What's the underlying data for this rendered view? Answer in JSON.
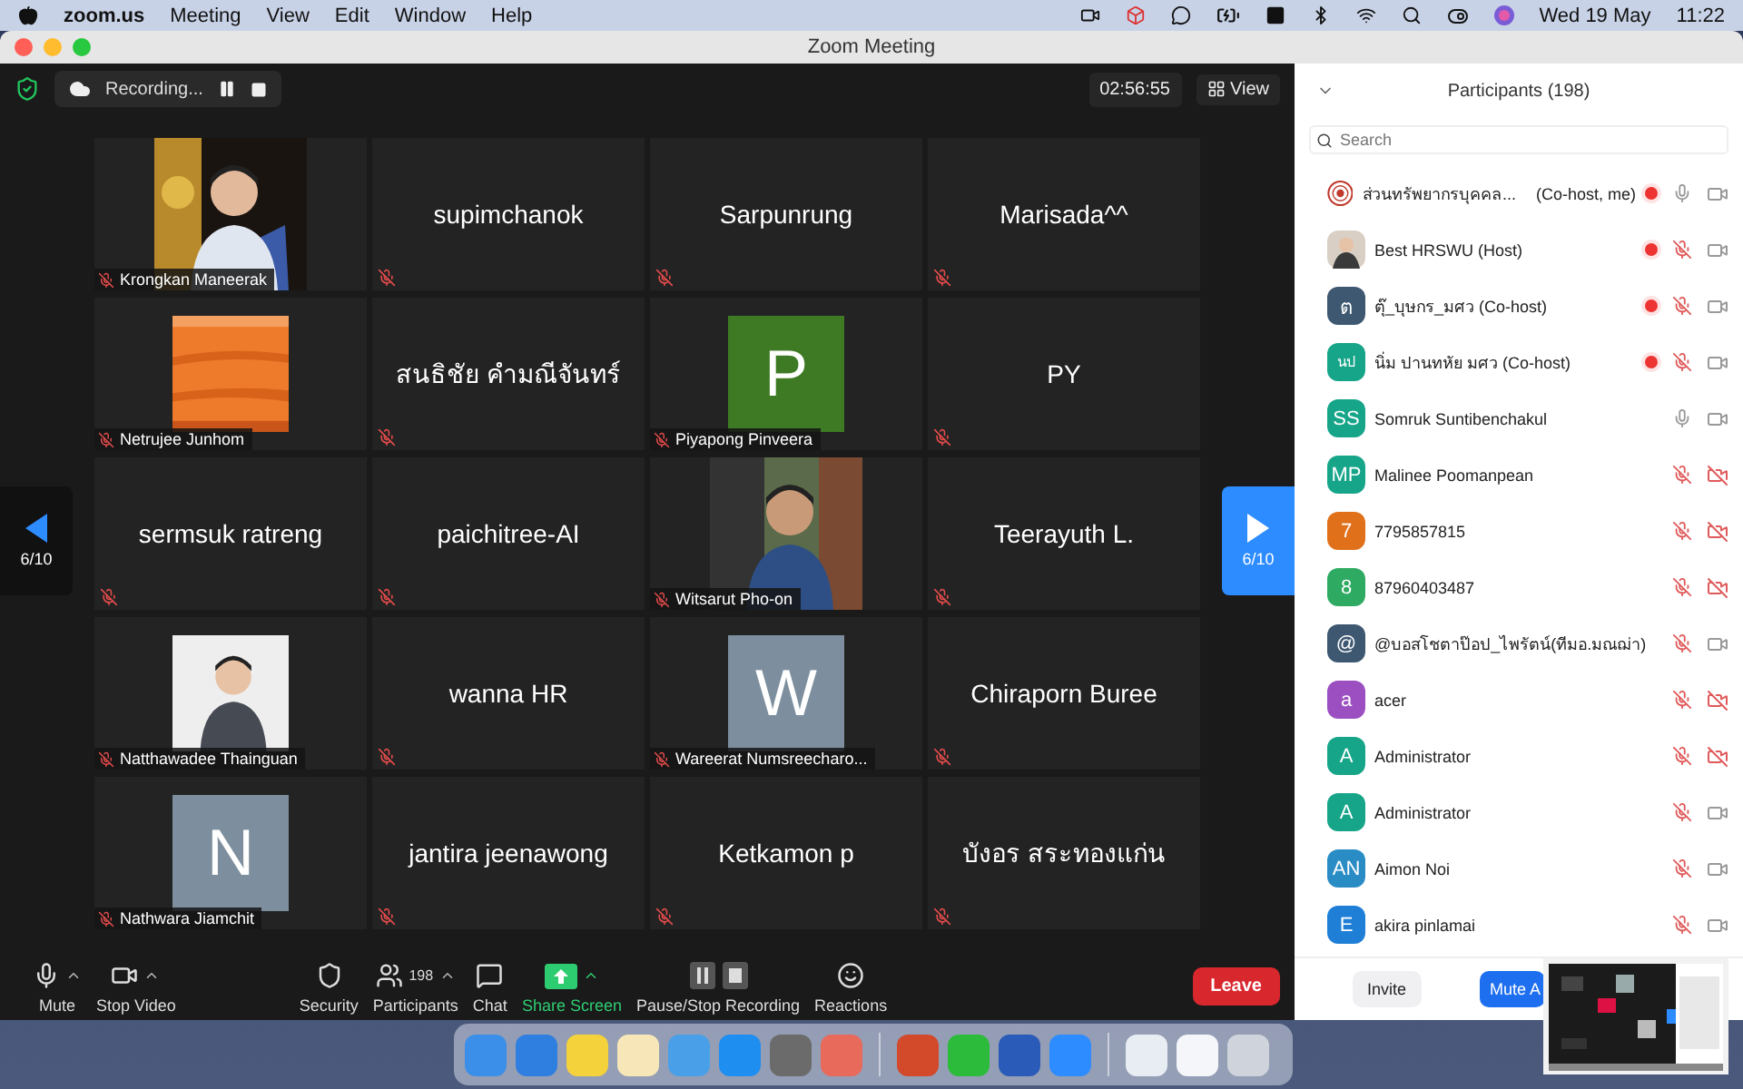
{
  "menu_bar": {
    "app": "zoom.us",
    "menus": [
      "Meeting",
      "View",
      "Edit",
      "Window",
      "Help"
    ],
    "date": "Wed 19 May",
    "time": "11:22"
  },
  "window": {
    "title": "Zoom Meeting"
  },
  "meeting_bar": {
    "recording": "Recording...",
    "timer": "02:56:55",
    "view": "View"
  },
  "pager": {
    "previous": "6/10",
    "next": "6/10"
  },
  "tiles": [
    {
      "name": "Krongkan Maneerak",
      "muted": true
    },
    {
      "kind": "name",
      "name": "supimchanok",
      "muted": true
    },
    {
      "kind": "name",
      "name": "Sarpunrung",
      "muted": true
    },
    {
      "kind": "name",
      "name": "Marisada^^",
      "muted": true
    },
    {
      "name": "Netrujee Junhom",
      "muted": true
    },
    {
      "kind": "name",
      "name": "สนธิชัย คำมณีจันทร์",
      "muted": true
    },
    {
      "kind": "avatar",
      "letter": "P",
      "color": "#3e7a23",
      "name": "Piyapong Pinveera",
      "muted": true
    },
    {
      "kind": "name",
      "name": "PY",
      "muted": true
    },
    {
      "kind": "name",
      "name": "sermsuk ratreng",
      "muted": true
    },
    {
      "kind": "name",
      "name": "paichitree-AI",
      "muted": true
    },
    {
      "name": "Witsarut Pho-on",
      "muted": true
    },
    {
      "kind": "name",
      "name": "Teerayuth L.",
      "muted": true
    },
    {
      "name": "Natthawadee Thainguan",
      "muted": true
    },
    {
      "kind": "name",
      "name": "wanna HR",
      "muted": true
    },
    {
      "kind": "avatar",
      "letter": "W",
      "color": "#7d8f9e",
      "name": "Wareerat Numsreecharo...",
      "muted": true
    },
    {
      "kind": "name",
      "name": "Chiraporn Buree",
      "muted": true
    },
    {
      "kind": "avatar",
      "letter": "N",
      "color": "#7d8f9e",
      "name": "Nathwara Jiamchit",
      "muted": true
    },
    {
      "kind": "name",
      "name": "jantira jeenawong",
      "muted": true
    },
    {
      "kind": "name",
      "name": "Ketkamon p",
      "muted": true
    },
    {
      "kind": "name",
      "name": "บังอร สระทองแก่น",
      "muted": true
    }
  ],
  "toolbar": {
    "items": [
      {
        "kind": "mic",
        "label": "Mute",
        "caret": true
      },
      {
        "kind": "video",
        "label": "Stop Video",
        "caret": true
      },
      {
        "kind": "security",
        "label": "Security",
        "caret": false
      },
      {
        "kind": "participants",
        "label": "Participants",
        "count": "198",
        "caret": true
      },
      {
        "kind": "chat",
        "label": "Chat",
        "caret": false
      },
      {
        "kind": "share",
        "label": "Share Screen",
        "caret": true
      },
      {
        "kind": "record",
        "label": "Pause/Stop Recording",
        "caret": false
      },
      {
        "kind": "reactions",
        "label": "Reactions",
        "caret": false
      }
    ],
    "leave": "Leave"
  },
  "participants_panel": {
    "title": "Participants (198)",
    "search": {
      "placeholder": "Search"
    },
    "rows": [
      {
        "avatar": {
          "kind": "logo"
        },
        "name": "ส่วนทรัพยากรบุคคล...",
        "role": "(Co-host, me)",
        "recording": true,
        "muted": false,
        "video_off": false
      },
      {
        "name": "Best HRSWU (Host)",
        "recording": true,
        "muted": true,
        "video_off": false
      },
      {
        "avatar": {
          "kind": "initials",
          "initials": "ต",
          "color": "#3d5870"
        },
        "name": "ตุ๊_บุษกร_มศว (Co-host)",
        "recording": true,
        "muted": true,
        "video_off": false
      },
      {
        "avatar": {
          "kind": "initials",
          "initials": "นป",
          "color": "#17a589"
        },
        "name": "นิ่ม ปานทหัย มศว (Co-host)",
        "recording": true,
        "muted": true,
        "video_off": false
      },
      {
        "avatar": {
          "kind": "initials",
          "initials": "SS",
          "color": "#17a589"
        },
        "name": "Somruk Suntibenchakul",
        "recording": false,
        "muted": false,
        "video_off": false
      },
      {
        "avatar": {
          "kind": "initials",
          "initials": "MP",
          "color": "#17a589"
        },
        "name": "Malinee Poomanpean",
        "recording": false,
        "muted": true,
        "video_off": true
      },
      {
        "avatar": {
          "kind": "initials",
          "initials": "7",
          "color": "#e0701a"
        },
        "name": "7795857815",
        "recording": false,
        "muted": true,
        "video_off": true
      },
      {
        "avatar": {
          "kind": "initials",
          "initials": "8",
          "color": "#2faa62"
        },
        "name": "87960403487",
        "recording": false,
        "muted": true,
        "video_off": true
      },
      {
        "avatar": {
          "kind": "initials",
          "initials": "@",
          "color": "#3d5870"
        },
        "name": "@บอสโชตาป๊อป_ไพรัตน์(ทีมอ.มณฌ่า)",
        "recording": false,
        "muted": true,
        "video_off": false
      },
      {
        "avatar": {
          "kind": "initials",
          "initials": "a",
          "color": "#9b4fc0"
        },
        "name": "acer",
        "recording": false,
        "muted": true,
        "video_off": true
      },
      {
        "avatar": {
          "kind": "initials",
          "initials": "A",
          "color": "#17a589"
        },
        "name": "Administrator",
        "recording": false,
        "muted": true,
        "video_off": true
      },
      {
        "avatar": {
          "kind": "initials",
          "initials": "A",
          "color": "#17a589"
        },
        "name": "Administrator",
        "recording": false,
        "muted": true,
        "video_off": false
      },
      {
        "avatar": {
          "kind": "initials",
          "initials": "AN",
          "color": "#2a8cc4"
        },
        "name": "Aimon Noi",
        "recording": false,
        "muted": true,
        "video_off": false
      },
      {
        "avatar": {
          "kind": "initials",
          "initials": "E",
          "color": "#1f7fd6"
        },
        "name": "akira pinlamai",
        "recording": false,
        "muted": true,
        "video_off": false
      }
    ],
    "buttons": [
      {
        "kind": "secondary",
        "label": "Invite"
      },
      {
        "kind": "primary",
        "label": "Mute A"
      }
    ]
  }
}
